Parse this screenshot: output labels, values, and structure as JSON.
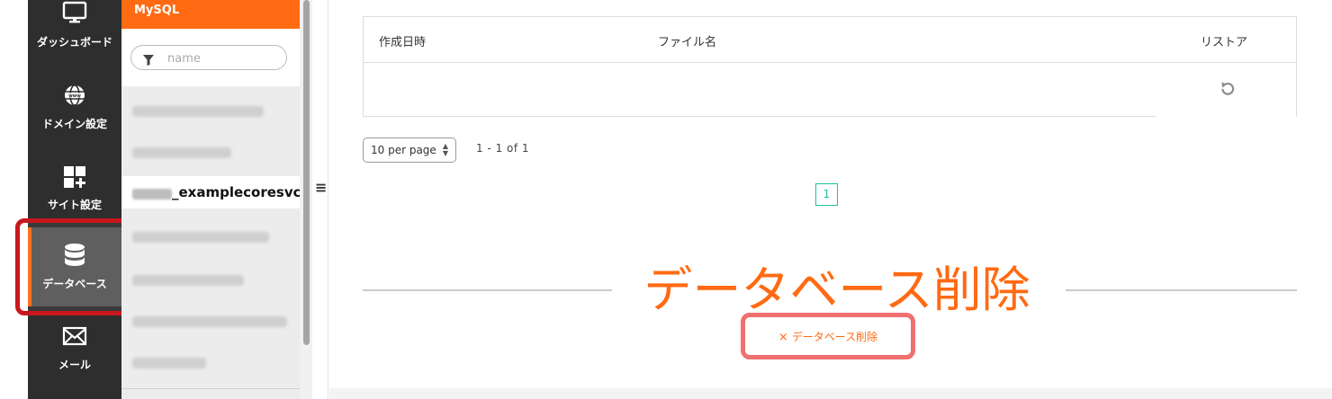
{
  "nav": {
    "items": [
      {
        "label": "ダッシュボード",
        "icon": "monitor-icon"
      },
      {
        "label": "ドメイン設定",
        "icon": "globe-icon"
      },
      {
        "label": "サイト設定",
        "icon": "add-widget-icon"
      },
      {
        "label": "データベース",
        "icon": "database-icon",
        "active": true
      },
      {
        "label": "メール",
        "icon": "mail-icon"
      }
    ]
  },
  "panel": {
    "title": "MySQL",
    "filter_placeholder": "name",
    "selected_db": "_examplecoresvco"
  },
  "table": {
    "headers": {
      "created": "作成日時",
      "filename": "ファイル名",
      "restore": "リストア"
    }
  },
  "pagination": {
    "per_page": "10 per page",
    "range": "1 - 1 of 1",
    "current_page": "1"
  },
  "section": {
    "title": "データベース削除",
    "delete_button": "データベース削除",
    "delete_icon": "×"
  },
  "colors": {
    "accent": "#ff6a13",
    "nav_bg": "#2e2e2e",
    "page_active": "#1fbf9a",
    "highlight_nav": "#c9171e",
    "highlight_button": "#f07070"
  }
}
